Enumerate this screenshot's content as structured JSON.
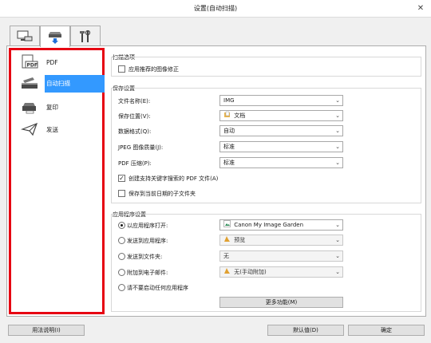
{
  "window": {
    "title": "设置(自动扫描)",
    "close_glyph": "✕"
  },
  "tabs": [
    {
      "name": "scan-from-computer"
    },
    {
      "name": "scan-from-operation-panel"
    },
    {
      "name": "general-settings"
    }
  ],
  "sidebar": {
    "items": [
      {
        "label": "PDF",
        "icon": "pdf-icon"
      },
      {
        "label": "自动扫描",
        "icon": "scanner-icon"
      },
      {
        "label": "复印",
        "icon": "copy-icon"
      },
      {
        "label": "发送",
        "icon": "send-icon"
      }
    ],
    "selected_index": 1
  },
  "scan_options": {
    "title": "扫描选项",
    "apply_correction_label": "应用推荐的图像修正",
    "apply_correction_checked": false
  },
  "save_settings": {
    "title": "保存设置",
    "file_name_label": "文件名称(E):",
    "file_name_value": "IMG",
    "save_in_label": "保存位置(V):",
    "save_in_value": "文档",
    "data_format_label": "数据格式(Q):",
    "data_format_value": "自动",
    "jpeg_quality_label": "JPEG 图像质量(J):",
    "jpeg_quality_value": "标准",
    "pdf_compression_label": "PDF 压缩(P):",
    "pdf_compression_value": "标准",
    "searchable_pdf_label": "创建支持关键字搜索的 PDF 文件(A)",
    "searchable_pdf_checked": true,
    "subfolder_label": "保存到当前日期的子文件夹",
    "subfolder_checked": false
  },
  "app_settings": {
    "title": "应用程序设置",
    "open_with_label": "以应用程序打开:",
    "open_with_value": "Canon My Image Garden",
    "send_to_app_label": "发送到应用程序:",
    "send_to_app_value": "预览",
    "send_to_folder_label": "发送到文件夹:",
    "send_to_folder_value": "无",
    "attach_email_label": "附加到电子邮件:",
    "attach_email_value": "无(手动附加)",
    "no_app_label": "请不要启动任何应用程序",
    "selected_option": "open_with",
    "more_functions_label": "更多功能(M)"
  },
  "footer": {
    "help_label": "用法说明(I)",
    "defaults_label": "默认值(D)",
    "ok_label": "确定"
  },
  "colors": {
    "selection": "#3399ff",
    "highlight_border": "#e60012"
  }
}
